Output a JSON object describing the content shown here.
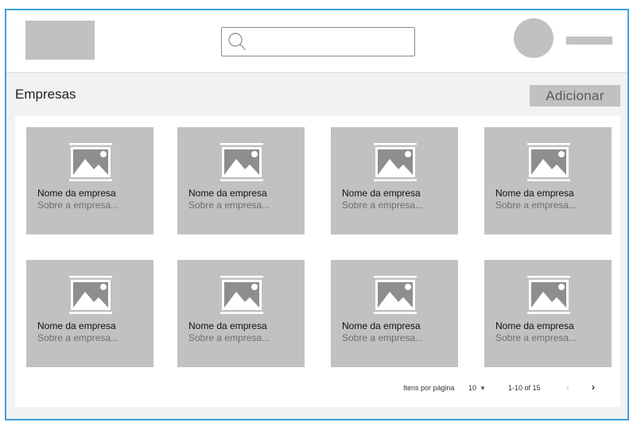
{
  "page": {
    "title": "Empresas",
    "add_label": "Adicionar"
  },
  "search": {
    "placeholder": ""
  },
  "cards": [
    {
      "name": "Nome da empresa",
      "about": "Sobre a empresa..."
    },
    {
      "name": "Nome da empresa",
      "about": "Sobre a empresa..."
    },
    {
      "name": "Nome da empresa",
      "about": "Sobre a empresa..."
    },
    {
      "name": "Nome da empresa",
      "about": "Sobre a empresa..."
    },
    {
      "name": "Nome da empresa",
      "about": "Sobre a empresa..."
    },
    {
      "name": "Nome da empresa",
      "about": "Sobre a empresa..."
    },
    {
      "name": "Nome da empresa",
      "about": "Sobre a empresa..."
    },
    {
      "name": "Nome da empresa",
      "about": "Sobre a empresa..."
    }
  ],
  "pagination": {
    "items_per_page_label": "Itens por página",
    "items_per_page_value": "10",
    "range_label": "1-10 of 15",
    "prev_icon": "chevron-left-icon",
    "next_icon": "chevron-right-icon"
  },
  "colors": {
    "frame_border": "#3fa0dc",
    "placeholder_gray": "#c1c1c1",
    "background": "#f2f2f2"
  }
}
